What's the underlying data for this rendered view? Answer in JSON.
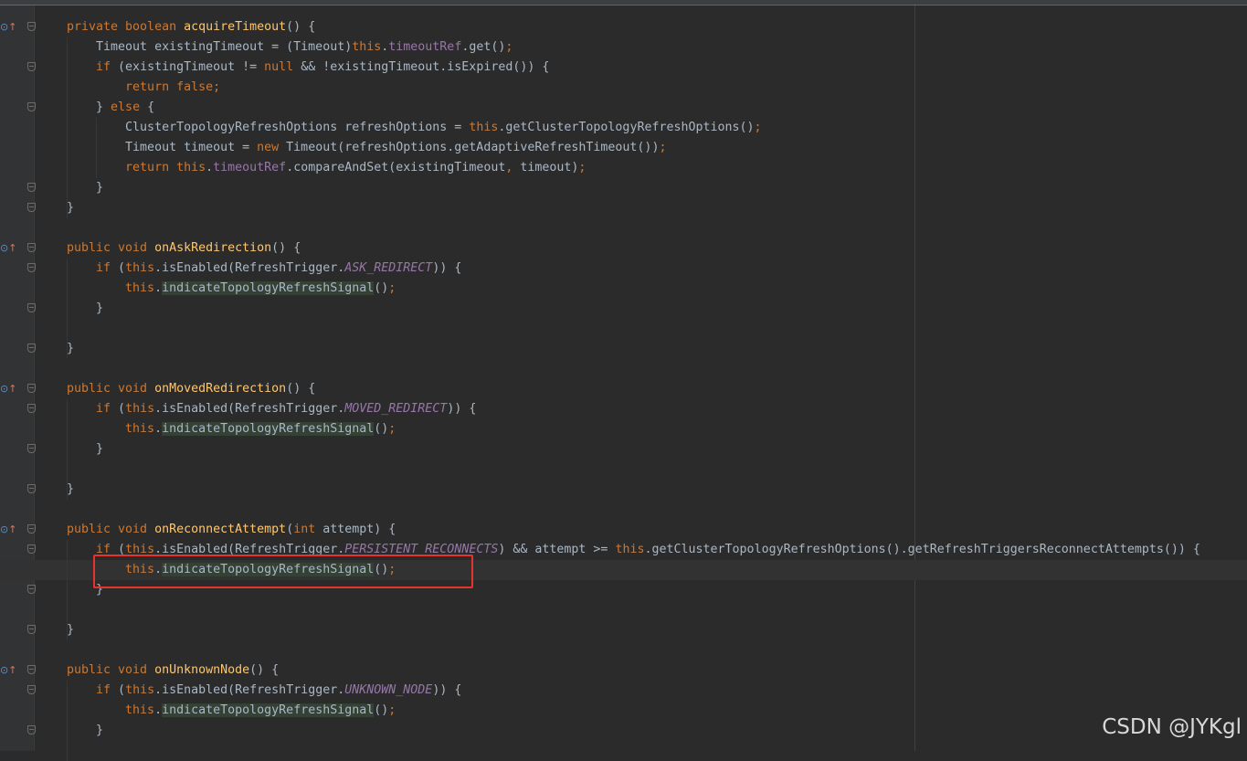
{
  "watermark": "CSDN @JYKgl",
  "colors": {
    "background": "#2b2b2b",
    "keyword": "#cc7832",
    "method_declaration": "#ffc66d",
    "field": "#9876aa",
    "default_text": "#a9b7c6",
    "method_highlight_bg": "#344134",
    "annotation_box": "#e8322c"
  },
  "gutter_icons": [
    "override-method-icon",
    "go-to-super-arrow-icon"
  ],
  "lines": [
    {
      "marker": true,
      "fold": true,
      "parts": [
        [
          "kw",
          "private boolean "
        ],
        [
          "fn",
          "acquireTimeout"
        ],
        [
          "",
          "() {"
        ]
      ]
    },
    {
      "fold": false,
      "parts": [
        [
          "",
          "    Timeout existingTimeout = (Timeout)"
        ],
        [
          "kw",
          "this"
        ],
        [
          "",
          "."
        ],
        [
          "fld",
          "timeoutRef"
        ],
        [
          "",
          ".get()"
        ],
        [
          "kw",
          ";"
        ]
      ]
    },
    {
      "fold": true,
      "parts": [
        [
          "kw",
          "    if "
        ],
        [
          "",
          "(existingTimeout != "
        ],
        [
          "kw",
          "null "
        ],
        [
          "",
          "&& !existingTimeout.isExpired()) {"
        ]
      ]
    },
    {
      "fold": false,
      "parts": [
        [
          "kw",
          "        return false;"
        ]
      ]
    },
    {
      "fold": true,
      "parts": [
        [
          "",
          "    } "
        ],
        [
          "kw",
          "else "
        ],
        [
          "",
          "{"
        ]
      ]
    },
    {
      "fold": false,
      "parts": [
        [
          "",
          "        ClusterTopologyRefreshOptions refreshOptions = "
        ],
        [
          "kw",
          "this"
        ],
        [
          "",
          ".getClusterTopologyRefreshOptions()"
        ],
        [
          "kw",
          ";"
        ]
      ]
    },
    {
      "fold": false,
      "parts": [
        [
          "",
          "        Timeout timeout = "
        ],
        [
          "kw",
          "new "
        ],
        [
          "",
          "Timeout(refreshOptions.getAdaptiveRefreshTimeout())"
        ],
        [
          "kw",
          ";"
        ]
      ]
    },
    {
      "fold": false,
      "parts": [
        [
          "kw",
          "        return this"
        ],
        [
          "",
          "."
        ],
        [
          "fld",
          "timeoutRef"
        ],
        [
          "",
          ".compareAndSet(existingTimeout"
        ],
        [
          "kw",
          ", "
        ],
        [
          "",
          "timeout)"
        ],
        [
          "kw",
          ";"
        ]
      ]
    },
    {
      "fold": true,
      "parts": [
        [
          "",
          "    }"
        ]
      ]
    },
    {
      "fold": true,
      "parts": [
        [
          "",
          "}"
        ]
      ]
    },
    {
      "fold": false,
      "parts": []
    },
    {
      "marker": true,
      "fold": true,
      "parts": [
        [
          "kw",
          "public void "
        ],
        [
          "fn",
          "onAskRedirection"
        ],
        [
          "",
          "() {"
        ]
      ]
    },
    {
      "fold": true,
      "parts": [
        [
          "kw",
          "    if "
        ],
        [
          "",
          "("
        ],
        [
          "kw",
          "this"
        ],
        [
          "",
          ".isEnabled(RefreshTrigger."
        ],
        [
          "cst",
          "ASK_REDIRECT"
        ],
        [
          "",
          "))"
        ],
        [
          "",
          " {"
        ]
      ]
    },
    {
      "fold": false,
      "parts": [
        [
          "kw",
          "        this"
        ],
        [
          "",
          "."
        ],
        [
          "hl",
          "indicateTopologyRefreshSignal"
        ],
        [
          "",
          "()"
        ],
        [
          "kw",
          ";"
        ]
      ]
    },
    {
      "fold": true,
      "parts": [
        [
          "",
          "    }"
        ]
      ]
    },
    {
      "fold": false,
      "parts": []
    },
    {
      "fold": true,
      "parts": [
        [
          "",
          "}"
        ]
      ]
    },
    {
      "fold": false,
      "parts": []
    },
    {
      "marker": true,
      "fold": true,
      "parts": [
        [
          "kw",
          "public void "
        ],
        [
          "fn",
          "onMovedRedirection"
        ],
        [
          "",
          "() {"
        ]
      ]
    },
    {
      "fold": true,
      "parts": [
        [
          "kw",
          "    if "
        ],
        [
          "",
          "("
        ],
        [
          "kw",
          "this"
        ],
        [
          "",
          ".isEnabled(RefreshTrigger."
        ],
        [
          "cst",
          "MOVED_REDIRECT"
        ],
        [
          "",
          ")) {"
        ]
      ]
    },
    {
      "fold": false,
      "parts": [
        [
          "kw",
          "        this"
        ],
        [
          "",
          "."
        ],
        [
          "hl",
          "indicateTopologyRefreshSignal"
        ],
        [
          "",
          "()"
        ],
        [
          "kw",
          ";"
        ]
      ]
    },
    {
      "fold": true,
      "parts": [
        [
          "",
          "    }"
        ]
      ]
    },
    {
      "fold": false,
      "parts": []
    },
    {
      "fold": true,
      "parts": [
        [
          "",
          "}"
        ]
      ]
    },
    {
      "fold": false,
      "parts": []
    },
    {
      "marker": true,
      "fold": true,
      "parts": [
        [
          "kw",
          "public void "
        ],
        [
          "fn",
          "onReconnectAttempt"
        ],
        [
          "",
          "("
        ],
        [
          "kw",
          "int "
        ],
        [
          "",
          "attempt) {"
        ]
      ]
    },
    {
      "fold": true,
      "parts": [
        [
          "kw",
          "    if "
        ],
        [
          "",
          "("
        ],
        [
          "kw",
          "this"
        ],
        [
          "",
          ".isEnabled(RefreshTrigger."
        ],
        [
          "cst",
          "PERSISTENT_RECONNECTS"
        ],
        [
          "",
          ") && attempt >= "
        ],
        [
          "kw",
          "this"
        ],
        [
          "",
          ".getClusterTopologyRefreshOptions().getRefreshTriggersReconnectAttempts()) {"
        ]
      ]
    },
    {
      "fold": false,
      "caret": true,
      "parts": [
        [
          "kw",
          "        this"
        ],
        [
          "",
          "."
        ],
        [
          "hl",
          "indicateTopologyRefreshSignal"
        ],
        [
          "",
          "()"
        ],
        [
          "kw",
          ";"
        ]
      ]
    },
    {
      "fold": true,
      "parts": [
        [
          "",
          "    }"
        ]
      ]
    },
    {
      "fold": false,
      "parts": []
    },
    {
      "fold": true,
      "parts": [
        [
          "",
          "}"
        ]
      ]
    },
    {
      "fold": false,
      "parts": []
    },
    {
      "marker": true,
      "fold": true,
      "parts": [
        [
          "kw",
          "public void "
        ],
        [
          "fn",
          "onUnknownNode"
        ],
        [
          "",
          "() {"
        ]
      ]
    },
    {
      "fold": true,
      "parts": [
        [
          "kw",
          "    if "
        ],
        [
          "",
          "("
        ],
        [
          "kw",
          "this"
        ],
        [
          "",
          ".isEnabled(RefreshTrigger."
        ],
        [
          "cst",
          "UNKNOWN_NODE"
        ],
        [
          "",
          ")) {"
        ]
      ]
    },
    {
      "fold": false,
      "parts": [
        [
          "kw",
          "        this"
        ],
        [
          "",
          "."
        ],
        [
          "hl",
          "indicateTopologyRefreshSignal"
        ],
        [
          "",
          "()"
        ],
        [
          "kw",
          ";"
        ]
      ]
    },
    {
      "fold": true,
      "parts": [
        [
          "",
          "    }"
        ]
      ]
    }
  ]
}
